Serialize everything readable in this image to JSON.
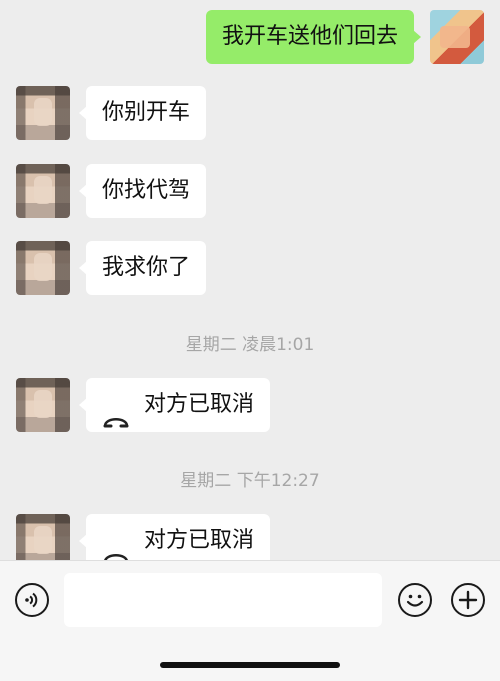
{
  "messages": [
    {
      "side": "right",
      "text": "我开车送他们回去"
    },
    {
      "side": "left",
      "text": "你别开车"
    },
    {
      "side": "left",
      "text": "你找代驾"
    },
    {
      "side": "left",
      "text": "我求你了"
    }
  ],
  "timestamps": [
    "星期二 凌晨1:01",
    "星期二 下午12:27"
  ],
  "calls": [
    {
      "text": "对方已取消",
      "icon": "phone-hangup-icon"
    },
    {
      "text": "对方已取消",
      "icon": "phone-hangup-icon"
    }
  ],
  "input_bar": {
    "input_value": "",
    "voice_icon": "voice-icon",
    "emoji_icon": "emoji-icon",
    "add_icon": "plus-icon"
  },
  "colors": {
    "background": "#ededed",
    "outgoing_bubble": "#95ec69",
    "incoming_bubble": "#ffffff",
    "timestamp": "#a6a6a6"
  }
}
